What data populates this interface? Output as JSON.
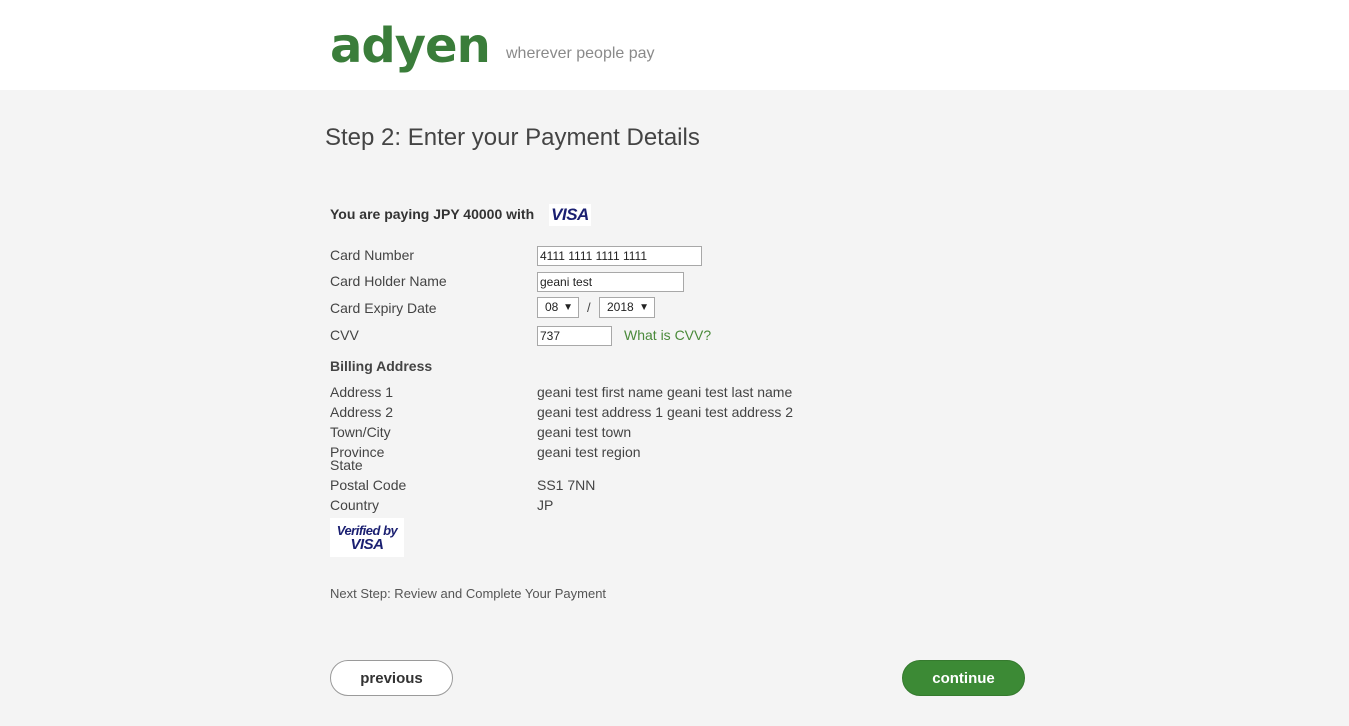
{
  "header": {
    "logo": "adyen",
    "tagline": "wherever people pay"
  },
  "page": {
    "title": "Step 2: Enter your Payment Details",
    "paying_text": "You are paying JPY 40000 with",
    "card_brand": "VISA"
  },
  "form": {
    "card_number_label": "Card Number",
    "card_number_value": "4111 1111 1111 1111",
    "holder_label": "Card Holder Name",
    "holder_value": "geani test",
    "expiry_label": "Card Expiry Date",
    "expiry_month": "08",
    "expiry_separator": "/",
    "expiry_year": "2018",
    "cvv_label": "CVV",
    "cvv_value": "737",
    "cvv_help": "What is CVV?"
  },
  "billing": {
    "title": "Billing Address",
    "rows": [
      {
        "label": "Address 1",
        "value": "geani test first name geani test last name"
      },
      {
        "label": "Address 2",
        "value": "geani test address 1 geani test address 2"
      },
      {
        "label": "Town/City",
        "value": "geani test town"
      },
      {
        "label": "Province",
        "label2": "State",
        "value": "geani test region"
      },
      {
        "label": "Postal Code",
        "value": "SS1 7NN"
      },
      {
        "label": "Country",
        "value": "JP"
      }
    ]
  },
  "verified_badge": {
    "line1": "Verified by",
    "line2": "VISA"
  },
  "next_step": "Next Step: Review and Complete Your Payment",
  "buttons": {
    "previous": "previous",
    "continue": "continue"
  },
  "colors": {
    "brand_green": "#3a7d3a",
    "continue_button": "#3c8a35",
    "link_green": "#4a8a3a",
    "visa_blue": "#1a1f71",
    "page_background": "#f4f4f4"
  }
}
